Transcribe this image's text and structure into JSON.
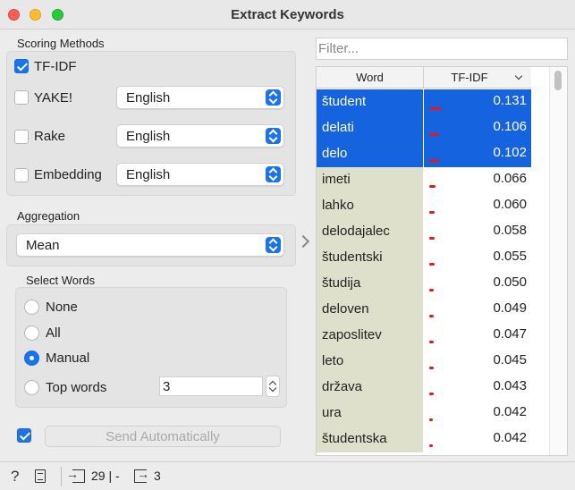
{
  "window": {
    "title": "Extract Keywords"
  },
  "scoring": {
    "label": "Scoring Methods",
    "tfidf": {
      "label": "TF-IDF",
      "checked": true
    },
    "yake": {
      "label": "YAKE!",
      "checked": false,
      "language": "English"
    },
    "rake": {
      "label": "Rake",
      "checked": false,
      "language": "English"
    },
    "embedding": {
      "label": "Embedding",
      "checked": false,
      "language": "English"
    }
  },
  "aggregation": {
    "label": "Aggregation",
    "value": "Mean"
  },
  "select_words": {
    "label": "Select Words",
    "options": [
      "None",
      "All",
      "Manual",
      "Top words"
    ],
    "selected": "Manual",
    "top_words_value": "3"
  },
  "send": {
    "auto_checked": true,
    "label": "Send Automatically"
  },
  "filter": {
    "placeholder": "Filter..."
  },
  "table": {
    "headers": {
      "word": "Word",
      "score": "TF-IDF"
    },
    "rows": [
      {
        "word": "študent",
        "score": "0.131",
        "selected": true
      },
      {
        "word": "delati",
        "score": "0.106",
        "selected": true
      },
      {
        "word": "delo",
        "score": "0.102",
        "selected": true
      },
      {
        "word": "imeti",
        "score": "0.066",
        "selected": false
      },
      {
        "word": "lahko",
        "score": "0.060",
        "selected": false
      },
      {
        "word": "delodajalec",
        "score": "0.058",
        "selected": false
      },
      {
        "word": "študentski",
        "score": "0.055",
        "selected": false
      },
      {
        "word": "študija",
        "score": "0.050",
        "selected": false
      },
      {
        "word": "deloven",
        "score": "0.049",
        "selected": false
      },
      {
        "word": "zaposlitev",
        "score": "0.047",
        "selected": false
      },
      {
        "word": "leto",
        "score": "0.045",
        "selected": false
      },
      {
        "word": "država",
        "score": "0.043",
        "selected": false
      },
      {
        "word": "ura",
        "score": "0.042",
        "selected": false
      },
      {
        "word": "študentska",
        "score": "0.042",
        "selected": false
      }
    ]
  },
  "status": {
    "input_text": "29 | -",
    "output_text": "3"
  },
  "colors": {
    "accent": "#1a73e8",
    "selection": "#1663e0",
    "bar": "#e81818",
    "word_cell": "#dfe0cc"
  }
}
